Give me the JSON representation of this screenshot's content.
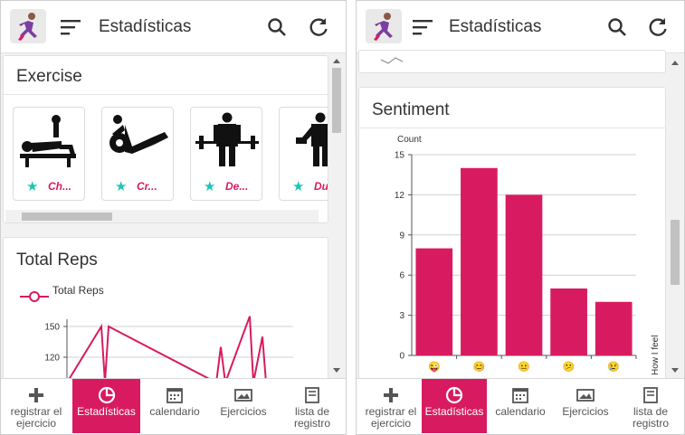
{
  "app": {
    "title": "Estadísticas"
  },
  "left": {
    "exercise_card": {
      "title": "Exercise",
      "items": [
        {
          "label": "Ch...",
          "icon": "bench-press-icon"
        },
        {
          "label": "Cr...",
          "icon": "crunch-icon"
        },
        {
          "label": "De...",
          "icon": "deadlift-icon"
        },
        {
          "label": "Du...",
          "icon": "dumbbell-curl-icon"
        }
      ]
    },
    "total_reps_card": {
      "title": "Total Reps",
      "legend": "Total Reps",
      "y_ticks": [
        "150",
        "120"
      ]
    }
  },
  "right": {
    "sentiment_card": {
      "title": "Sentiment",
      "y_axis_label": "Count",
      "x_axis_label": "How I feel"
    }
  },
  "chart_data": [
    {
      "type": "bar",
      "title": "Sentiment",
      "ylabel": "Count",
      "xlabel": "How I feel",
      "categories": [
        "😜",
        "😊",
        "😐",
        "😕",
        "😢"
      ],
      "values": [
        8,
        14,
        12,
        5,
        4
      ],
      "ylim": [
        0,
        15
      ],
      "y_ticks": [
        0,
        3,
        6,
        9,
        12,
        15
      ],
      "grid": true,
      "color": "#d81b60"
    },
    {
      "type": "line",
      "title": "Total Reps",
      "series": [
        {
          "name": "Total Reps",
          "values": [
            110,
            150,
            110,
            150,
            110,
            130,
            110,
            160,
            110,
            140,
            110
          ]
        }
      ],
      "y_ticks": [
        150,
        120
      ],
      "color": "#d81b60"
    }
  ],
  "bottom_nav": [
    {
      "label": "registrar el ejercicio",
      "icon": "plus-icon",
      "active": false
    },
    {
      "label": "Estadísticas",
      "icon": "pie-chart-icon",
      "active": true
    },
    {
      "label": "calendario",
      "icon": "calendar-icon",
      "active": false
    },
    {
      "label": "Ejercicios",
      "icon": "gallery-icon",
      "active": false
    },
    {
      "label": "lista de registro",
      "icon": "book-icon",
      "active": false
    }
  ],
  "colors": {
    "accent": "#d81b60",
    "star": "#1fc4b4"
  }
}
